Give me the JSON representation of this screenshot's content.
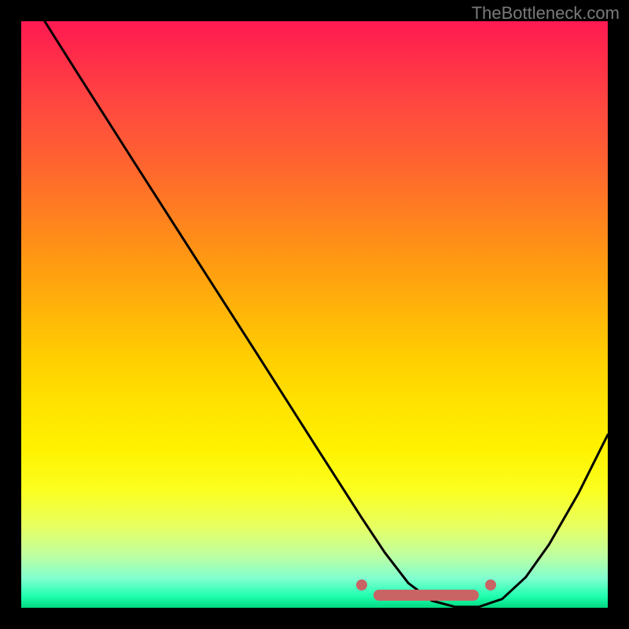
{
  "watermark": "TheBottleneck.com",
  "chart_data": {
    "type": "line",
    "title": "",
    "xlabel": "",
    "ylabel": "",
    "xlim": [
      0,
      100
    ],
    "ylim": [
      0,
      100
    ],
    "grid": false,
    "background": "vertical-gradient red→yellow→green",
    "series": [
      {
        "name": "curve",
        "color": "#000000",
        "x": [
          4,
          10,
          20,
          30,
          40,
          50,
          55,
          58,
          62,
          66,
          70,
          74,
          78,
          82,
          86,
          90,
          95,
          100
        ],
        "values": [
          100,
          90.5,
          74.8,
          59.2,
          43.6,
          27.9,
          20.1,
          15.4,
          9.4,
          4.2,
          1.2,
          0.15,
          0.15,
          1.5,
          5.2,
          10.8,
          19.5,
          29.5
        ]
      }
    ],
    "markers": {
      "band": {
        "x_start": 60,
        "x_end": 78,
        "y": 0.15,
        "color": "#c96464"
      },
      "dots": [
        {
          "x": 58,
          "y": 1.6,
          "color": "#c96464"
        },
        {
          "x": 80,
          "y": 1.6,
          "color": "#c96464"
        }
      ]
    }
  },
  "colors": {
    "frame": "#000000",
    "curve": "#000000",
    "marker": "#c96464",
    "watermark": "#7a7a7a"
  }
}
